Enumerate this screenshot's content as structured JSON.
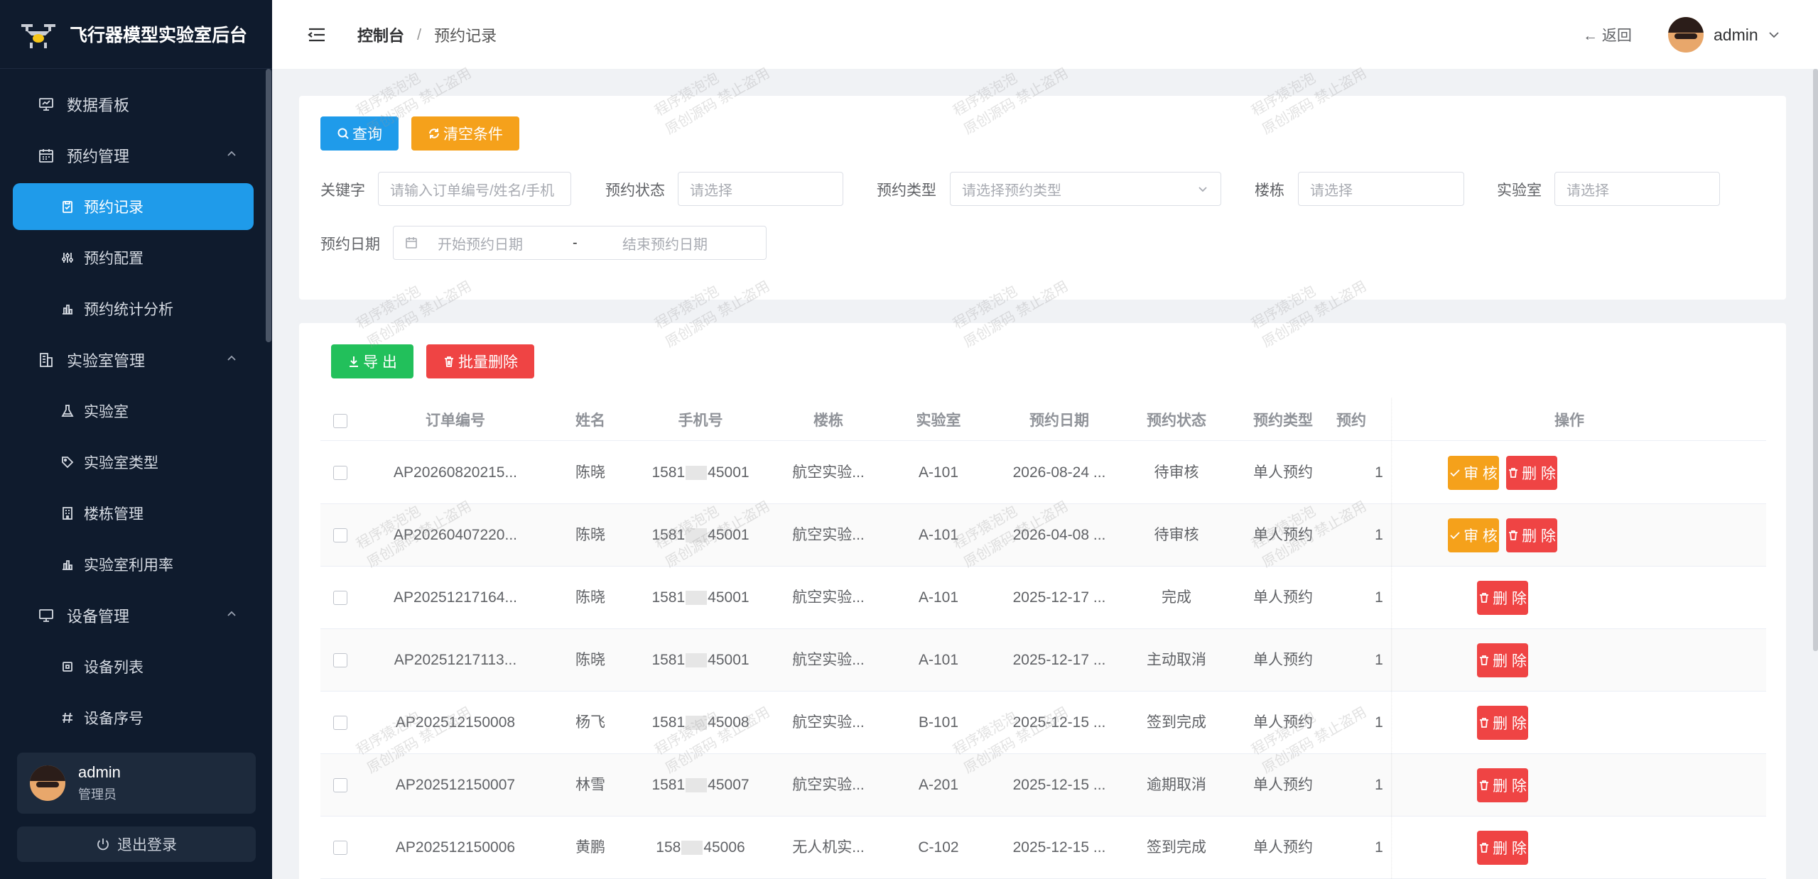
{
  "app": {
    "title": "飞行器模型实验室后台"
  },
  "sidebar": {
    "items": [
      {
        "label": "数据看板",
        "icon": "monitor-icon",
        "level": 1
      },
      {
        "label": "预约管理",
        "icon": "calendar-icon",
        "level": 1,
        "expanded": true
      },
      {
        "label": "预约记录",
        "icon": "clipboard-icon",
        "level": 2,
        "active": true
      },
      {
        "label": "预约配置",
        "icon": "sliders-icon",
        "level": 2
      },
      {
        "label": "预约统计分析",
        "icon": "bar-chart-icon",
        "level": 2
      },
      {
        "label": "实验室管理",
        "icon": "building-icon",
        "level": 1,
        "expanded": true
      },
      {
        "label": "实验室",
        "icon": "flask-icon",
        "level": 2
      },
      {
        "label": "实验室类型",
        "icon": "tag-icon",
        "level": 2
      },
      {
        "label": "楼栋管理",
        "icon": "office-icon",
        "level": 2
      },
      {
        "label": "实验室利用率",
        "icon": "bar-chart-icon",
        "level": 2
      },
      {
        "label": "设备管理",
        "icon": "computer-icon",
        "level": 1,
        "expanded": true
      },
      {
        "label": "设备列表",
        "icon": "chip-icon",
        "level": 2
      },
      {
        "label": "设备序号",
        "icon": "hash-icon",
        "level": 2
      }
    ],
    "user": {
      "name": "admin",
      "role": "管理员"
    },
    "logout_label": "退出登录"
  },
  "header": {
    "breadcrumb": [
      "控制台",
      "预约记录"
    ],
    "breadcrumb_sep": "/",
    "back_label": "← 返回",
    "user_name": "admin"
  },
  "filter": {
    "query_label": "查询",
    "clear_label": "清空条件",
    "keyword": {
      "label": "关键字",
      "placeholder": "请输入订单编号/姓名/手机"
    },
    "status": {
      "label": "预约状态",
      "placeholder": "请选择"
    },
    "type": {
      "label": "预约类型",
      "placeholder": "请选择预约类型"
    },
    "building": {
      "label": "楼栋",
      "placeholder": "请选择"
    },
    "lab": {
      "label": "实验室",
      "placeholder": "请选择"
    },
    "date": {
      "label": "预约日期",
      "start_placeholder": "开始预约日期",
      "sep": "-",
      "end_placeholder": "结束预约日期"
    }
  },
  "toolbar": {
    "export_label": "导 出",
    "batch_delete_label": "批量删除"
  },
  "table": {
    "columns": [
      "订单编号",
      "姓名",
      "手机号",
      "楼栋",
      "实验室",
      "预约日期",
      "预约状态",
      "预约类型",
      "预约",
      "操作"
    ],
    "rows": [
      {
        "order": "AP20260820215...",
        "name": "陈晓",
        "phone_a": "1581",
        "phone_b": "45001",
        "building": "航空实验...",
        "lab": "A-101",
        "date": "2026-08-24 ...",
        "status": "待审核",
        "type": "单人预约",
        "extra": "1",
        "actions": [
          "审 核",
          "删 除"
        ]
      },
      {
        "order": "AP20260407220...",
        "name": "陈晓",
        "phone_a": "1581",
        "phone_b": "45001",
        "building": "航空实验...",
        "lab": "A-101",
        "date": "2026-04-08 ...",
        "status": "待审核",
        "type": "单人预约",
        "extra": "1",
        "actions": [
          "审 核",
          "删 除"
        ]
      },
      {
        "order": "AP20251217164...",
        "name": "陈晓",
        "phone_a": "1581",
        "phone_b": "45001",
        "building": "航空实验...",
        "lab": "A-101",
        "date": "2025-12-17 ...",
        "status": "完成",
        "type": "单人预约",
        "extra": "1",
        "actions": [
          "删 除"
        ]
      },
      {
        "order": "AP20251217113...",
        "name": "陈晓",
        "phone_a": "1581",
        "phone_b": "45001",
        "building": "航空实验...",
        "lab": "A-101",
        "date": "2025-12-17 ...",
        "status": "主动取消",
        "type": "单人预约",
        "extra": "1",
        "actions": [
          "删 除"
        ]
      },
      {
        "order": "AP202512150008",
        "name": "杨飞",
        "phone_a": "1581",
        "phone_b": "45008",
        "building": "航空实验...",
        "lab": "B-101",
        "date": "2025-12-15 ...",
        "status": "签到完成",
        "type": "单人预约",
        "extra": "1",
        "actions": [
          "删 除"
        ]
      },
      {
        "order": "AP202512150007",
        "name": "林雪",
        "phone_a": "1581",
        "phone_b": "45007",
        "building": "航空实验...",
        "lab": "A-201",
        "date": "2025-12-15 ...",
        "status": "逾期取消",
        "type": "单人预约",
        "extra": "1",
        "actions": [
          "删 除"
        ]
      },
      {
        "order": "AP202512150006",
        "name": "黄鹏",
        "phone_a": "158",
        "phone_b": "45006",
        "building": "无人机实...",
        "lab": "C-102",
        "date": "2025-12-15 ...",
        "status": "签到完成",
        "type": "单人预约",
        "extra": "1",
        "actions": [
          "删 除"
        ]
      }
    ]
  },
  "watermark": {
    "line1": "程序猿泡泡",
    "line2": "原创源码 禁止盗用"
  },
  "colors": {
    "sidebar_bg": "#0f1b2d",
    "primary": "#1f9bea",
    "warning": "#f5a11b",
    "success": "#22c05b",
    "danger": "#ef4444"
  }
}
